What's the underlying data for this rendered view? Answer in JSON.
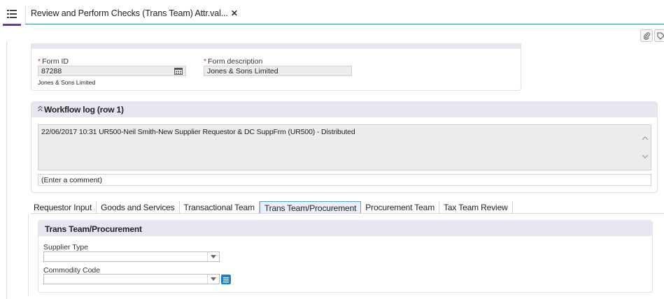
{
  "topbar": {
    "menu_icon": "list-menu-icon",
    "tab_title": "Review and Perform Checks (Trans Team) Attr.val...",
    "close_glyph": "✕"
  },
  "toolbar_icons": [
    "paperclip-icon",
    "tag-icon"
  ],
  "form": {
    "form_id_label": "Form ID",
    "form_id_value": "87288",
    "form_id_note": "Jones & Sons Limited",
    "form_desc_label": "Form description",
    "form_desc_value": "Jones & Sons Limited",
    "required_marker": "*"
  },
  "workflow": {
    "title": "Workflow log (row 1)",
    "collapse_glyph": "≈",
    "entry": "22/06/2017 10:31 UR500-Neil Smith-New Supplier Requestor & DC SuppFrm (UR500) - Distributed",
    "comment_placeholder": "(Enter a comment)"
  },
  "tabs": [
    {
      "label": "Requestor Input"
    },
    {
      "label": "Goods and Services"
    },
    {
      "label": "Transactional Team"
    },
    {
      "label": "Trans Team/Procurement",
      "active": true
    },
    {
      "label": "Procurement Team"
    },
    {
      "label": "Tax Team Review"
    }
  ],
  "trans_team": {
    "title": "Trans Team/Procurement",
    "supplier_type_label": "Supplier Type",
    "supplier_type_value": "",
    "commodity_code_label": "Commodity Code",
    "commodity_code_value": ""
  },
  "colors": {
    "accent_line": "#2f8fa7",
    "menu_underline": "#6a3d8f",
    "panel_header": "#e7e5f0",
    "required": "#d9251d",
    "lookup_button": "#1e7fd1"
  }
}
